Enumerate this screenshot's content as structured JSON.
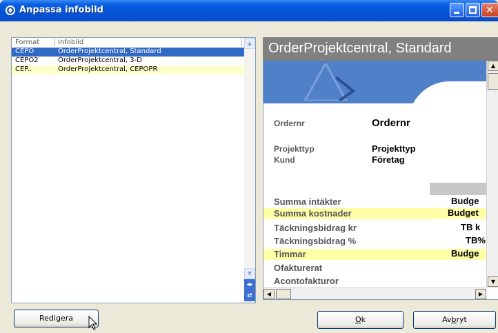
{
  "window": {
    "title": "Anpassa infobild",
    "icon": "app-icon"
  },
  "list": {
    "headers": {
      "format": "Format",
      "infobild": "Infobild"
    },
    "rows": [
      {
        "format": "CEPO",
        "infobild": "OrderProjektcentral, Standard",
        "state": "selected"
      },
      {
        "format": "CEPO2",
        "infobild": "OrderProjektcentral, 3-D",
        "state": "normal"
      },
      {
        "format": "CEP..",
        "infobild": "OrderProjektcentral, CEPOPR",
        "state": "highlighted"
      }
    ]
  },
  "preview": {
    "title": "OrderProjektcentral, Standard",
    "ordernr_label": "Ordernr",
    "ordernr_value": "Ordernr",
    "projekttyp_label": "Projekttyp",
    "projekttyp_value": "Projekttyp",
    "kund_label": "Kund",
    "kund_value": "Företag",
    "rows": [
      {
        "label": "Summa intäkter",
        "value": "Budge"
      },
      {
        "label": "Summa kostnader",
        "value": "Budget"
      },
      {
        "label": "Täckningsbidrag kr",
        "value": "TB k"
      },
      {
        "label": "Täckningsbidrag %",
        "value": "TB%"
      },
      {
        "label": "Timmar",
        "value": "Budge"
      },
      {
        "label": "Ofakturerat",
        "value": ""
      },
      {
        "label": "Acontofakturor",
        "value": ""
      }
    ]
  },
  "buttons": {
    "redigera": "Redigera",
    "ok_underlined": "O",
    "ok_rest": "k",
    "avbryt_pre": "Av",
    "avbryt_underlined": "b",
    "avbryt_rest": "ryt"
  },
  "colors": {
    "selection": "#316ac5",
    "highlight": "#ffffcc",
    "titlebar": "#0554d8",
    "preview_header": "#808080"
  }
}
